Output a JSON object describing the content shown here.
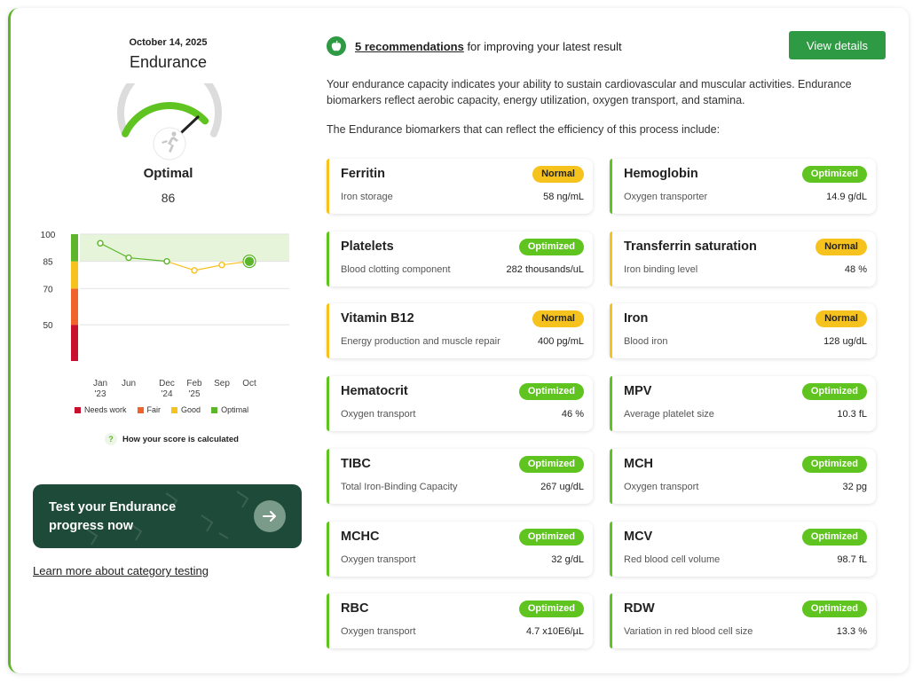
{
  "date": "October 14, 2025",
  "category": "Endurance",
  "gauge_level": 0.86,
  "status": "Optimal",
  "score": "86",
  "chart_data": {
    "type": "line",
    "x": [
      "Jan '23",
      "Jun",
      "Dec '24",
      "Feb '25",
      "Sep",
      "Oct"
    ],
    "xlabels": [
      [
        "Jan",
        "'23"
      ],
      [
        "Jun",
        ""
      ],
      [
        "Dec",
        "'24"
      ],
      [
        "Feb",
        "'25"
      ],
      [
        "Sep",
        ""
      ],
      [
        "Oct",
        ""
      ]
    ],
    "values": [
      95,
      87,
      85,
      80,
      83,
      85
    ],
    "point_colors": [
      "#5db52b",
      "#5db52b",
      "#5db52b",
      "#f6c21d",
      "#f6c21d",
      "#5db52b"
    ],
    "y_ticks": [
      "100",
      "85",
      "70",
      "50"
    ],
    "ylim": [
      30,
      100
    ],
    "optimal_band": [
      85,
      100
    ],
    "bands": [
      {
        "from": 30,
        "to": 50,
        "color": "#c8102e"
      },
      {
        "from": 50,
        "to": 70,
        "color": "#f0632a"
      },
      {
        "from": 70,
        "to": 85,
        "color": "#f6c21d"
      },
      {
        "from": 85,
        "to": 100,
        "color": "#5db52b"
      }
    ],
    "legend": [
      {
        "label": "Needs work",
        "color": "#c8102e"
      },
      {
        "label": "Fair",
        "color": "#f0632a"
      },
      {
        "label": "Good",
        "color": "#f6c21d"
      },
      {
        "label": "Optimal",
        "color": "#5db52b"
      }
    ]
  },
  "how_score": "How your score is calculated",
  "cta": {
    "line1": "Test your Endurance",
    "line2": "progress now",
    "icon": "arrow-right-icon"
  },
  "learn_more": "Learn more about category testing",
  "recommendations": {
    "link": "5 recommendations",
    "rest": " for improving your latest result",
    "icon": "apple-icon"
  },
  "view_details": "View details",
  "intro": "Your endurance capacity indicates your ability to sustain cardiovascular and muscular activities. Endurance biomarkers reflect aerobic capacity, energy utilization, oxygen transport, and stamina.",
  "intro2": "The Endurance biomarkers that can reflect the efficiency of this process include:",
  "colors": {
    "normal": "#f6c21d",
    "optimized": "#5fc41f",
    "accent": "#2e9a44",
    "cta_bg": "#1e4a3a"
  },
  "biomarkers": [
    {
      "name": "Ferritin",
      "status": "Normal",
      "desc": "Iron storage",
      "value": "58 ng/mL"
    },
    {
      "name": "Hemoglobin",
      "status": "Optimized",
      "desc": "Oxygen transporter",
      "value": "14.9 g/dL"
    },
    {
      "name": "Platelets",
      "status": "Optimized",
      "desc": "Blood clotting component",
      "value": "282 thousands/uL"
    },
    {
      "name": "Transferrin saturation",
      "status": "Normal",
      "desc": "Iron binding level",
      "value": "48 %"
    },
    {
      "name": "Vitamin B12",
      "status": "Normal",
      "desc": "Energy production and muscle repair",
      "value": "400 pg/mL"
    },
    {
      "name": "Iron",
      "status": "Normal",
      "desc": "Blood iron",
      "value": "128 ug/dL"
    },
    {
      "name": "Hematocrit",
      "status": "Optimized",
      "desc": "Oxygen transport",
      "value": "46 %"
    },
    {
      "name": "MPV",
      "status": "Optimized",
      "desc": "Average platelet size",
      "value": "10.3 fL"
    },
    {
      "name": "TIBC",
      "status": "Optimized",
      "desc": "Total Iron-Binding Capacity",
      "value": "267 ug/dL"
    },
    {
      "name": "MCH",
      "status": "Optimized",
      "desc": "Oxygen transport",
      "value": "32 pg"
    },
    {
      "name": "MCHC",
      "status": "Optimized",
      "desc": "Oxygen transport",
      "value": "32 g/dL"
    },
    {
      "name": "MCV",
      "status": "Optimized",
      "desc": "Red blood cell volume",
      "value": "98.7 fL"
    },
    {
      "name": "RBC",
      "status": "Optimized",
      "desc": "Oxygen transport",
      "value": "4.7 x10E6/µL"
    },
    {
      "name": "RDW",
      "status": "Optimized",
      "desc": "Variation in red blood cell size",
      "value": "13.3 %"
    }
  ]
}
